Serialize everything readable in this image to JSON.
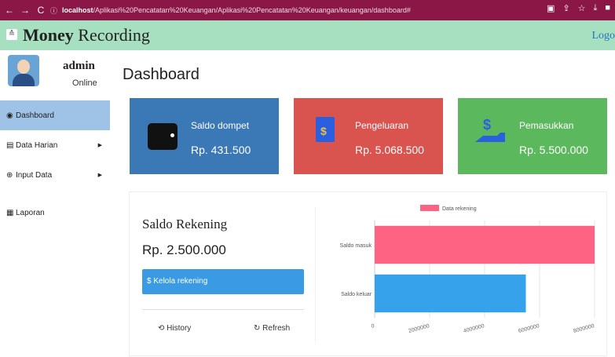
{
  "browser": {
    "url_host": "localhost",
    "url_path": "/Aplikasi%20Pencatatan%20Keuangan/Aplikasi%20Pencatatan%20Keuangan/keuangan/dashboard#"
  },
  "header": {
    "brand_bold": "Money",
    "brand_rest": " Recording",
    "logout": "Logo"
  },
  "user": {
    "name": "admin",
    "status": "Online"
  },
  "sidebar": {
    "items": [
      {
        "label": "Dashboard",
        "icon": "dashboard-icon",
        "active": true
      },
      {
        "label": "Data Harian",
        "icon": "database-icon",
        "has_submenu": true
      },
      {
        "label": "Input Data",
        "icon": "plus-circle-icon",
        "has_submenu": true
      },
      {
        "label": "Laporan",
        "icon": "report-icon"
      }
    ]
  },
  "main": {
    "title": "Dashboard",
    "cards": [
      {
        "label": "Saldo dompet",
        "value": "Rp. 431.500",
        "color": "#3b79b6",
        "icon": "wallet-icon"
      },
      {
        "label": "Pengeluaran",
        "value": "Rp. 5.068.500",
        "color": "#d9534f",
        "icon": "invoice-icon"
      },
      {
        "label": "Pemasukkan",
        "value": "Rp. 5.500.000",
        "color": "#5cb85c",
        "icon": "hand-money-icon"
      }
    ],
    "rekening": {
      "title": "Saldo Rekening",
      "value": "Rp. 2.500.000",
      "button": "Kelola rekening",
      "history": "History",
      "refresh": "Refresh"
    }
  },
  "chart_data": {
    "type": "bar",
    "orientation": "horizontal",
    "categories": [
      "Saldo masuk",
      "Saldo keluar"
    ],
    "series": [
      {
        "name": "Data rekening",
        "values": [
          8000000,
          5500000
        ],
        "colors": [
          "#ff6384",
          "#36a2eb"
        ]
      }
    ],
    "x_ticks": [
      "0",
      "2000000",
      "4000000",
      "6000000",
      "8000000"
    ],
    "xlim": [
      0,
      8000000
    ],
    "legend": "top"
  }
}
